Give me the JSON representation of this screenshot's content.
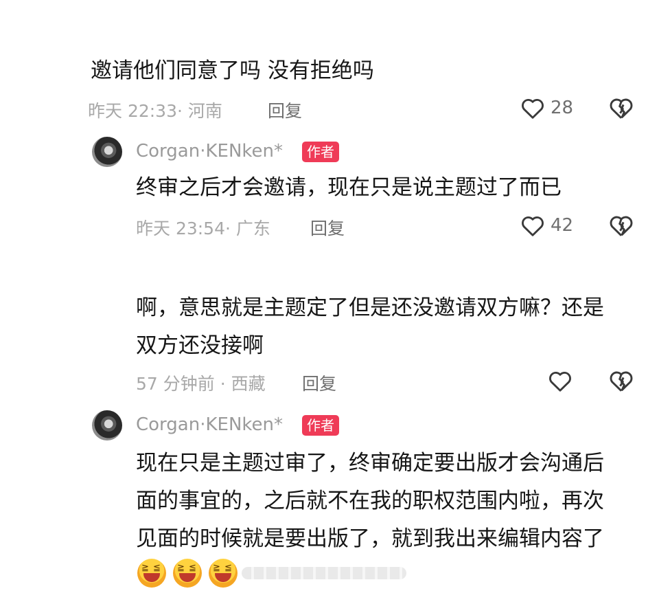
{
  "comments": [
    {
      "text": "邀请他们同意了吗 没有拒绝吗",
      "meta": "昨天 22:33· 河南",
      "reply_label": "回复",
      "likes": "28"
    },
    {
      "author": "Corgan·KENken*",
      "badge": "作者",
      "text": "终审之后才会邀请，现在只是说主题过了而已",
      "meta": "昨天 23:54· 广东",
      "reply_label": "回复",
      "likes": "42"
    },
    {
      "text_line1": "啊，意思就是主题定了但是还没邀请双方嘛？还是",
      "text_line2": "双方还没接啊",
      "meta": "57 分钟前 · 西藏",
      "reply_label": "回复",
      "likes": ""
    },
    {
      "author": "Corgan·KENken*",
      "badge": "作者",
      "text_line1": "现在只是主题过审了，终审确定要出版才会沟通后",
      "text_line2": "面的事宜的，之后就不在我的职权范围内啦，再次",
      "text_line3": "见面的时候就是要出版了，就到我出来编辑内容了",
      "emojis": [
        "laughing-emoji",
        "laughing-emoji",
        "laughing-emoji"
      ]
    }
  ],
  "icons": {
    "like": "heart-outline-icon",
    "dislike": "broken-heart-icon"
  },
  "colors": {
    "badge": "#ef3b57",
    "meta_text": "#a8a8a8",
    "main_text": "#161616"
  }
}
